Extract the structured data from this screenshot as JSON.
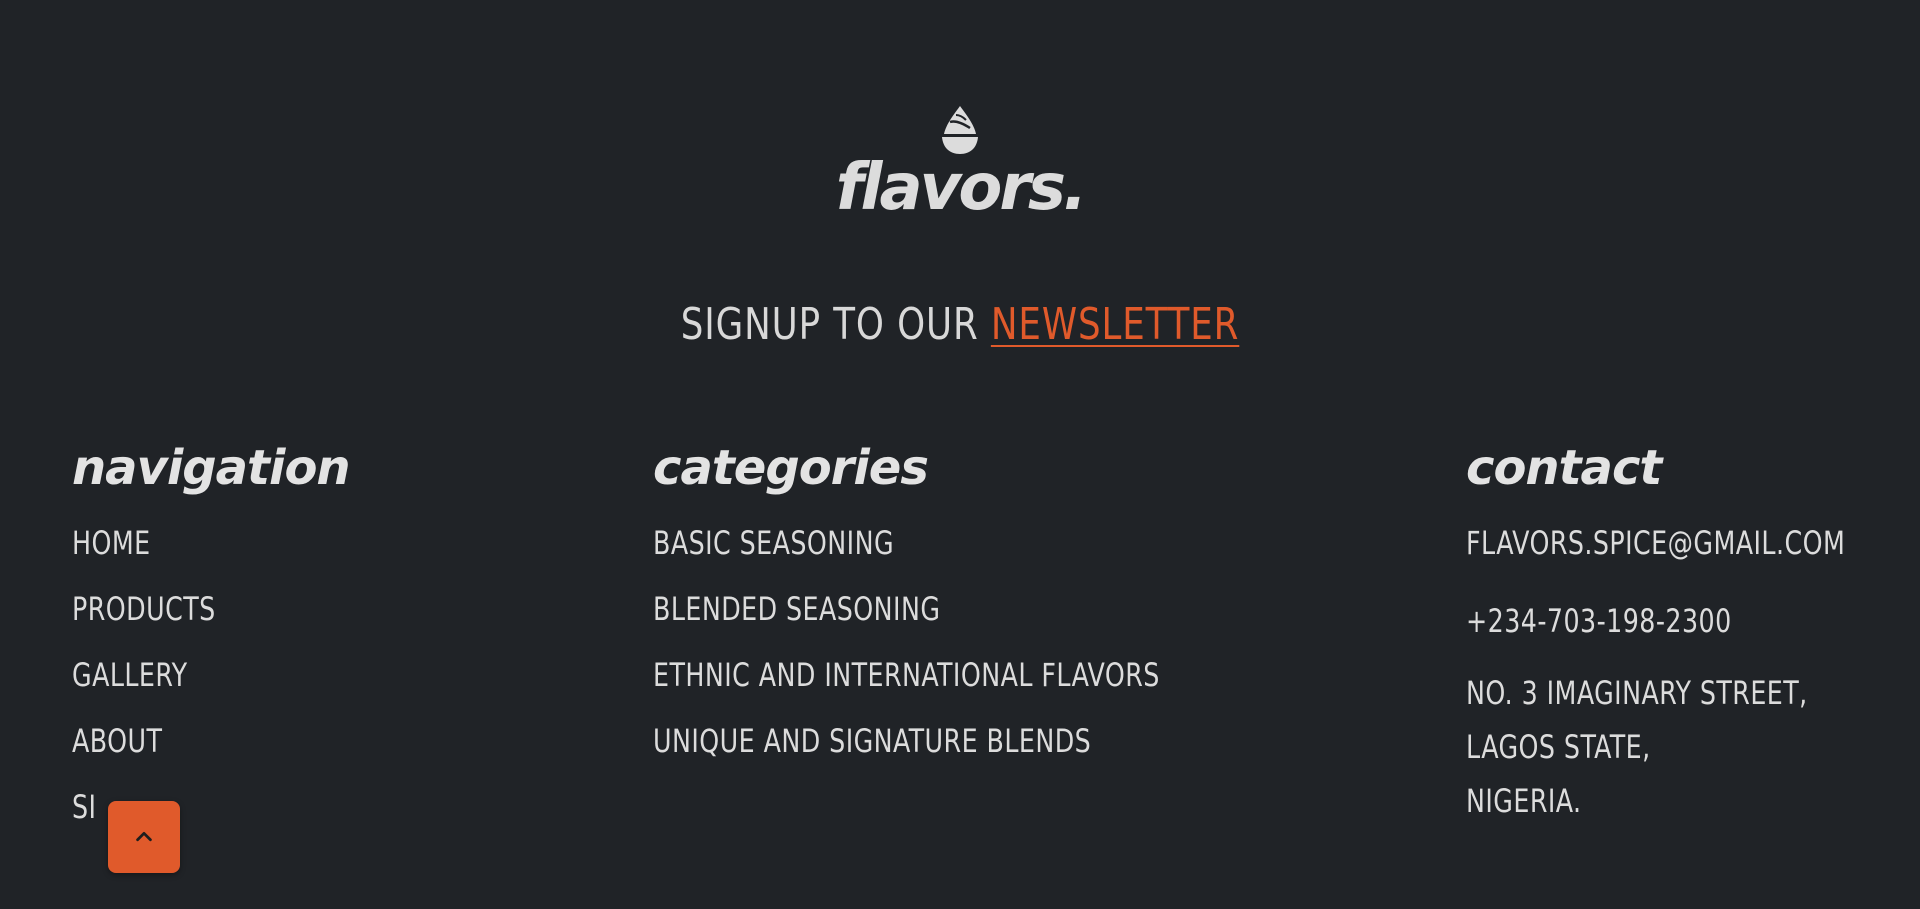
{
  "brand": {
    "logo_icon": "spice-mound-icon",
    "name": "flavors."
  },
  "newsletter": {
    "prefix": "SIGNUP TO OUR",
    "link_label": "NEWSLETTER"
  },
  "navigation": {
    "title": "navigation",
    "items": [
      "HOME",
      "PRODUCTS",
      "GALLERY",
      "ABOUT",
      "SI"
    ]
  },
  "categories": {
    "title": "categories",
    "items": [
      "BASIC SEASONING",
      "BLENDED SEASONING",
      "ETHNIC AND INTERNATIONAL FLAVORS",
      "UNIQUE AND SIGNATURE BLENDS"
    ]
  },
  "contact": {
    "title": "contact",
    "email": "FLAVORS.SPICE@GMAIL.COM",
    "phone": "+234-703-198-2300",
    "address": [
      "NO. 3 IMAGINARY STREET,",
      "LAGOS STATE,",
      "NIGERIA."
    ]
  },
  "scroll_top": {
    "icon": "chevron-up-icon"
  },
  "colors": {
    "background": "#202327",
    "accent": "#e05a2b",
    "text": "#dcdcdc"
  }
}
